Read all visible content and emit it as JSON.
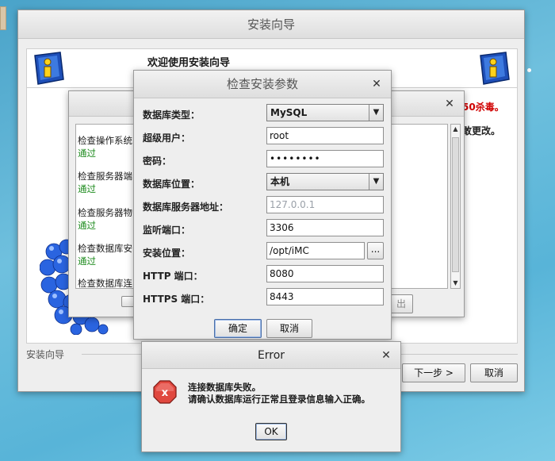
{
  "main": {
    "title": "安装向导",
    "welcome": "欢迎使用安装向导",
    "red_text": "50杀毒。",
    "black_text": "敢更改。",
    "separator_label": "安装向导",
    "next_button": "下一步 >",
    "cancel_button": "取消"
  },
  "check_dialog": {
    "items": [
      {
        "label": "检查操作系统",
        "status": "通过"
      },
      {
        "label": "检查服务器端",
        "status": "通过"
      },
      {
        "label": "检查服务器物",
        "status": "通过"
      },
      {
        "label": "检查数据库安",
        "status": "通过"
      },
      {
        "label": "检查数据库连",
        "status": ""
      }
    ],
    "partial_button": "出"
  },
  "params_dialog": {
    "title": "检查安装参数",
    "fields": {
      "db_type": {
        "label": "数据库类型：",
        "value": "MySQL"
      },
      "super_user": {
        "label": "超级用户：",
        "value": "root"
      },
      "password": {
        "label": "密码：",
        "value": "••••••••"
      },
      "db_location": {
        "label": "数据库位置：",
        "value": "本机"
      },
      "db_server_addr": {
        "label": "数据库服务器地址：",
        "value": "127.0.0.1"
      },
      "listen_port": {
        "label": "监听端口：",
        "value": "3306"
      },
      "install_location": {
        "label": "安装位置：",
        "value": "/opt/iMC",
        "browse": "..."
      },
      "http_port": {
        "label": "HTTP 端口：",
        "value": "8080"
      },
      "https_port": {
        "label": "HTTPS 端口：",
        "value": "8443"
      }
    },
    "ok_button": "确定",
    "cancel_button": "取消"
  },
  "error_dialog": {
    "title": "Error",
    "line1": "连接数据库失败。",
    "line2": "请确认数据库运行正常且登录信息输入正确。",
    "ok_button": "OK"
  },
  "colors": {
    "pass_green": "#1c8a1c",
    "warn_red": "#d00000",
    "error_icon": "#d32f2f"
  }
}
